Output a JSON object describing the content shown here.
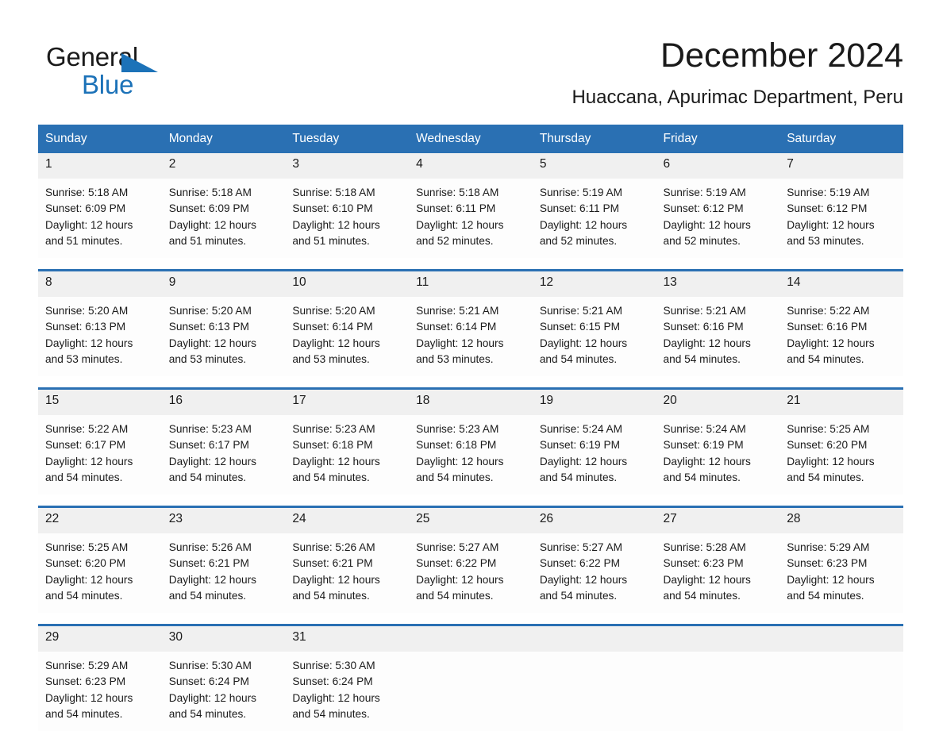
{
  "brand": {
    "name_part1": "General",
    "name_part2": "Blue",
    "triangle_color": "#1c72b8"
  },
  "header": {
    "title": "December 2024",
    "subtitle": "Huaccana, Apurimac Department, Peru"
  },
  "theme": {
    "header_blue": "#2a70b3",
    "daynum_gray": "#f0f0f0",
    "cell_white": "#fdfdfd",
    "text_dark": "#1a1a1a"
  },
  "weekdays": [
    "Sunday",
    "Monday",
    "Tuesday",
    "Wednesday",
    "Thursday",
    "Friday",
    "Saturday"
  ],
  "weeks": [
    [
      {
        "day": "1",
        "sunrise": "Sunrise: 5:18 AM",
        "sunset": "Sunset: 6:09 PM",
        "daylight1": "Daylight: 12 hours",
        "daylight2": "and 51 minutes."
      },
      {
        "day": "2",
        "sunrise": "Sunrise: 5:18 AM",
        "sunset": "Sunset: 6:09 PM",
        "daylight1": "Daylight: 12 hours",
        "daylight2": "and 51 minutes."
      },
      {
        "day": "3",
        "sunrise": "Sunrise: 5:18 AM",
        "sunset": "Sunset: 6:10 PM",
        "daylight1": "Daylight: 12 hours",
        "daylight2": "and 51 minutes."
      },
      {
        "day": "4",
        "sunrise": "Sunrise: 5:18 AM",
        "sunset": "Sunset: 6:11 PM",
        "daylight1": "Daylight: 12 hours",
        "daylight2": "and 52 minutes."
      },
      {
        "day": "5",
        "sunrise": "Sunrise: 5:19 AM",
        "sunset": "Sunset: 6:11 PM",
        "daylight1": "Daylight: 12 hours",
        "daylight2": "and 52 minutes."
      },
      {
        "day": "6",
        "sunrise": "Sunrise: 5:19 AM",
        "sunset": "Sunset: 6:12 PM",
        "daylight1": "Daylight: 12 hours",
        "daylight2": "and 52 minutes."
      },
      {
        "day": "7",
        "sunrise": "Sunrise: 5:19 AM",
        "sunset": "Sunset: 6:12 PM",
        "daylight1": "Daylight: 12 hours",
        "daylight2": "and 53 minutes."
      }
    ],
    [
      {
        "day": "8",
        "sunrise": "Sunrise: 5:20 AM",
        "sunset": "Sunset: 6:13 PM",
        "daylight1": "Daylight: 12 hours",
        "daylight2": "and 53 minutes."
      },
      {
        "day": "9",
        "sunrise": "Sunrise: 5:20 AM",
        "sunset": "Sunset: 6:13 PM",
        "daylight1": "Daylight: 12 hours",
        "daylight2": "and 53 minutes."
      },
      {
        "day": "10",
        "sunrise": "Sunrise: 5:20 AM",
        "sunset": "Sunset: 6:14 PM",
        "daylight1": "Daylight: 12 hours",
        "daylight2": "and 53 minutes."
      },
      {
        "day": "11",
        "sunrise": "Sunrise: 5:21 AM",
        "sunset": "Sunset: 6:14 PM",
        "daylight1": "Daylight: 12 hours",
        "daylight2": "and 53 minutes."
      },
      {
        "day": "12",
        "sunrise": "Sunrise: 5:21 AM",
        "sunset": "Sunset: 6:15 PM",
        "daylight1": "Daylight: 12 hours",
        "daylight2": "and 54 minutes."
      },
      {
        "day": "13",
        "sunrise": "Sunrise: 5:21 AM",
        "sunset": "Sunset: 6:16 PM",
        "daylight1": "Daylight: 12 hours",
        "daylight2": "and 54 minutes."
      },
      {
        "day": "14",
        "sunrise": "Sunrise: 5:22 AM",
        "sunset": "Sunset: 6:16 PM",
        "daylight1": "Daylight: 12 hours",
        "daylight2": "and 54 minutes."
      }
    ],
    [
      {
        "day": "15",
        "sunrise": "Sunrise: 5:22 AM",
        "sunset": "Sunset: 6:17 PM",
        "daylight1": "Daylight: 12 hours",
        "daylight2": "and 54 minutes."
      },
      {
        "day": "16",
        "sunrise": "Sunrise: 5:23 AM",
        "sunset": "Sunset: 6:17 PM",
        "daylight1": "Daylight: 12 hours",
        "daylight2": "and 54 minutes."
      },
      {
        "day": "17",
        "sunrise": "Sunrise: 5:23 AM",
        "sunset": "Sunset: 6:18 PM",
        "daylight1": "Daylight: 12 hours",
        "daylight2": "and 54 minutes."
      },
      {
        "day": "18",
        "sunrise": "Sunrise: 5:23 AM",
        "sunset": "Sunset: 6:18 PM",
        "daylight1": "Daylight: 12 hours",
        "daylight2": "and 54 minutes."
      },
      {
        "day": "19",
        "sunrise": "Sunrise: 5:24 AM",
        "sunset": "Sunset: 6:19 PM",
        "daylight1": "Daylight: 12 hours",
        "daylight2": "and 54 minutes."
      },
      {
        "day": "20",
        "sunrise": "Sunrise: 5:24 AM",
        "sunset": "Sunset: 6:19 PM",
        "daylight1": "Daylight: 12 hours",
        "daylight2": "and 54 minutes."
      },
      {
        "day": "21",
        "sunrise": "Sunrise: 5:25 AM",
        "sunset": "Sunset: 6:20 PM",
        "daylight1": "Daylight: 12 hours",
        "daylight2": "and 54 minutes."
      }
    ],
    [
      {
        "day": "22",
        "sunrise": "Sunrise: 5:25 AM",
        "sunset": "Sunset: 6:20 PM",
        "daylight1": "Daylight: 12 hours",
        "daylight2": "and 54 minutes."
      },
      {
        "day": "23",
        "sunrise": "Sunrise: 5:26 AM",
        "sunset": "Sunset: 6:21 PM",
        "daylight1": "Daylight: 12 hours",
        "daylight2": "and 54 minutes."
      },
      {
        "day": "24",
        "sunrise": "Sunrise: 5:26 AM",
        "sunset": "Sunset: 6:21 PM",
        "daylight1": "Daylight: 12 hours",
        "daylight2": "and 54 minutes."
      },
      {
        "day": "25",
        "sunrise": "Sunrise: 5:27 AM",
        "sunset": "Sunset: 6:22 PM",
        "daylight1": "Daylight: 12 hours",
        "daylight2": "and 54 minutes."
      },
      {
        "day": "26",
        "sunrise": "Sunrise: 5:27 AM",
        "sunset": "Sunset: 6:22 PM",
        "daylight1": "Daylight: 12 hours",
        "daylight2": "and 54 minutes."
      },
      {
        "day": "27",
        "sunrise": "Sunrise: 5:28 AM",
        "sunset": "Sunset: 6:23 PM",
        "daylight1": "Daylight: 12 hours",
        "daylight2": "and 54 minutes."
      },
      {
        "day": "28",
        "sunrise": "Sunrise: 5:29 AM",
        "sunset": "Sunset: 6:23 PM",
        "daylight1": "Daylight: 12 hours",
        "daylight2": "and 54 minutes."
      }
    ],
    [
      {
        "day": "29",
        "sunrise": "Sunrise: 5:29 AM",
        "sunset": "Sunset: 6:23 PM",
        "daylight1": "Daylight: 12 hours",
        "daylight2": "and 54 minutes."
      },
      {
        "day": "30",
        "sunrise": "Sunrise: 5:30 AM",
        "sunset": "Sunset: 6:24 PM",
        "daylight1": "Daylight: 12 hours",
        "daylight2": "and 54 minutes."
      },
      {
        "day": "31",
        "sunrise": "Sunrise: 5:30 AM",
        "sunset": "Sunset: 6:24 PM",
        "daylight1": "Daylight: 12 hours",
        "daylight2": "and 54 minutes."
      },
      {
        "day": "",
        "sunrise": "",
        "sunset": "",
        "daylight1": "",
        "daylight2": ""
      },
      {
        "day": "",
        "sunrise": "",
        "sunset": "",
        "daylight1": "",
        "daylight2": ""
      },
      {
        "day": "",
        "sunrise": "",
        "sunset": "",
        "daylight1": "",
        "daylight2": ""
      },
      {
        "day": "",
        "sunrise": "",
        "sunset": "",
        "daylight1": "",
        "daylight2": ""
      }
    ]
  ]
}
